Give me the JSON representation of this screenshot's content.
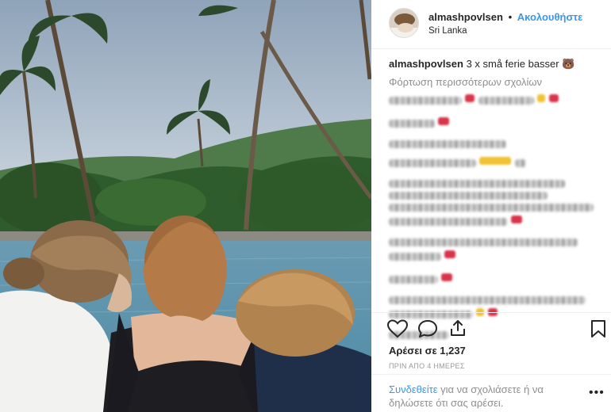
{
  "post": {
    "username": "almashpovlsen",
    "follow_label": "Ακολουθήστε",
    "separator": "•",
    "location": "Sri Lanka",
    "caption_text": "3 x små ferie basser 🐻",
    "load_more": "Φόρτωση περισσότερων σχολίων",
    "likes": "Αρέσει σε 1,237",
    "time": "ΠΡΙΝ ΑΠΟ 4 ΗΜΕΡΕΣ"
  },
  "add_comment": {
    "link": "Συνδεθείτε",
    "rest": " για να σχολιάσετε ή να δηλώσετε ότι σας αρέσει."
  },
  "more_label": "•••",
  "icons": {
    "like": "heart-icon",
    "comment": "comment-icon",
    "share": "share-icon",
    "save": "bookmark-icon",
    "more": "more-options-icon"
  },
  "colors": {
    "accent": "#3897f0",
    "text": "#262626",
    "muted": "#8e8e8e"
  }
}
